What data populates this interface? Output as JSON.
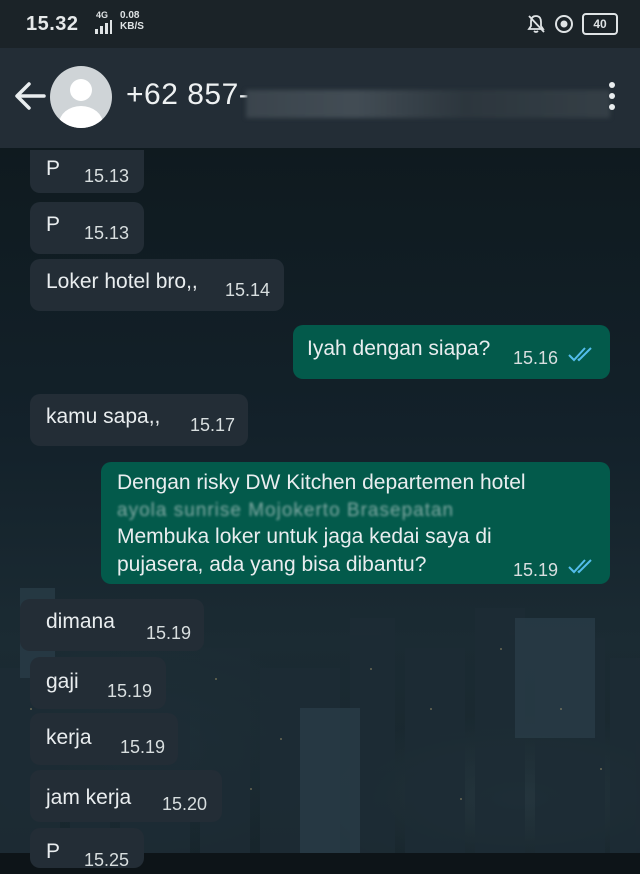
{
  "status_bar": {
    "time": "15.32",
    "network": "4G",
    "speed_value": "0.08",
    "speed_unit": "KB/S",
    "battery": "40"
  },
  "header": {
    "contact_name": "+62 857-"
  },
  "messages": [
    {
      "dir": "in",
      "text": "P",
      "time": "15.13"
    },
    {
      "dir": "in",
      "text": "P",
      "time": "15.13"
    },
    {
      "dir": "in",
      "text": "Loker hotel bro,,",
      "time": "15.14"
    },
    {
      "dir": "out",
      "text": "Iyah dengan siapa?",
      "time": "15.16",
      "status": "read"
    },
    {
      "dir": "in",
      "text": "kamu sapa,,",
      "time": "15.17"
    },
    {
      "dir": "out",
      "lines": [
        "Dengan risky DW Kitchen departemen hotel",
        "ayola sunrise Mojokerto Brasepatan",
        "Membuka loker untuk jaga kedai saya di",
        "pujasera, ada yang bisa dibantu?"
      ],
      "time": "15.19",
      "status": "read"
    },
    {
      "dir": "in",
      "text": "dimana",
      "time": "15.19"
    },
    {
      "dir": "in",
      "text": "gaji",
      "time": "15.19"
    },
    {
      "dir": "in",
      "text": "kerja",
      "time": "15.19"
    },
    {
      "dir": "in",
      "text": "jam kerja",
      "time": "15.20"
    },
    {
      "dir": "in",
      "text": "P",
      "time": "15.25"
    }
  ],
  "colors": {
    "incoming_bubble": "#232d36",
    "outgoing_bubble": "#035a4b",
    "read_ticks": "#53bdeb"
  }
}
